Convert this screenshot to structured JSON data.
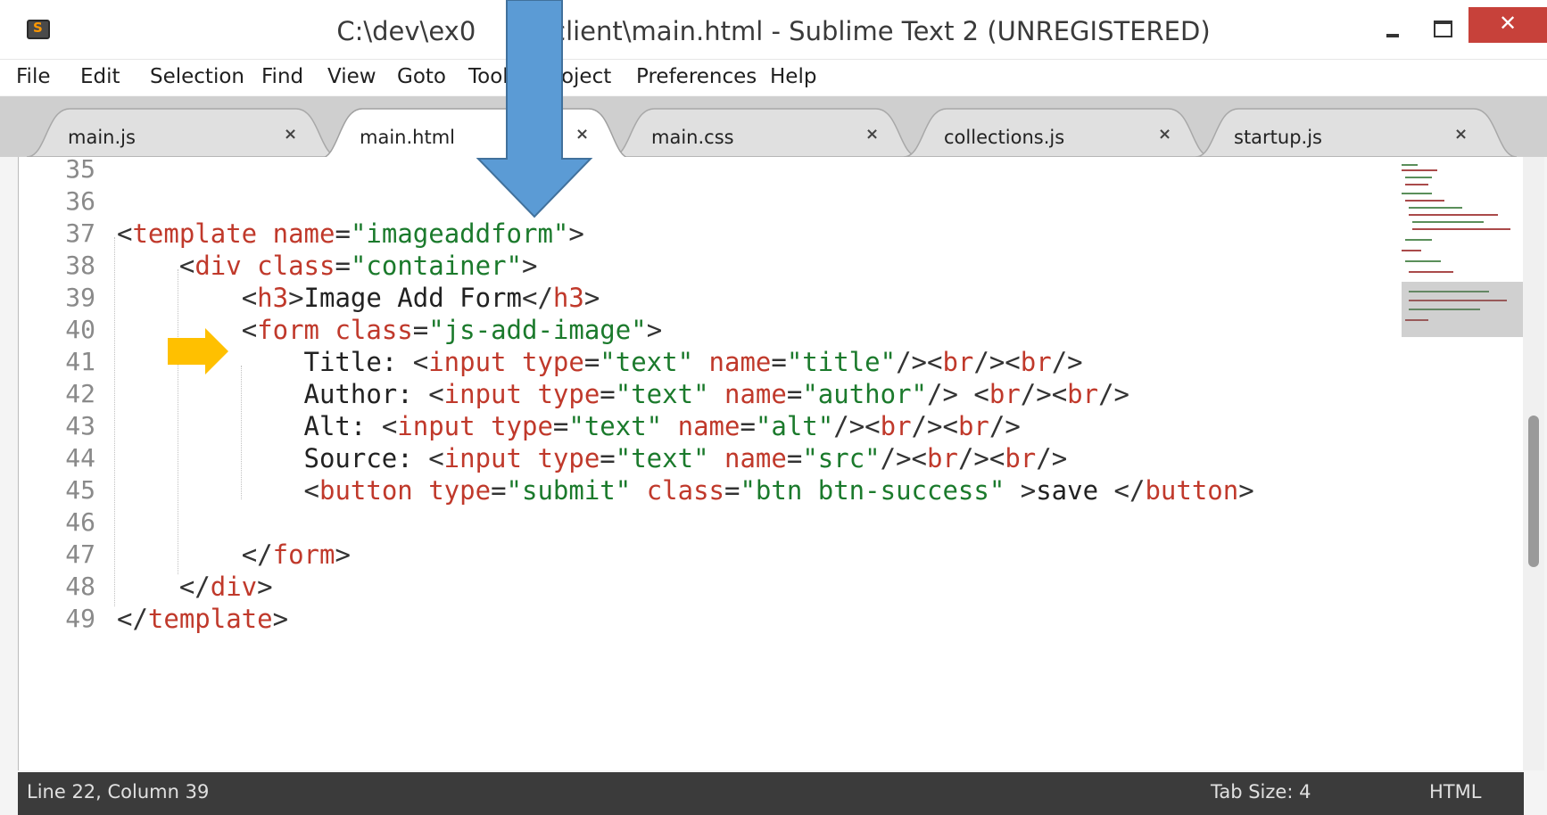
{
  "window": {
    "title": "C:\\dev\\ex0          v\\client\\main.html - Sublime Text 2 (UNREGISTERED)"
  },
  "menu": {
    "items": [
      "File",
      "Edit",
      "Selection",
      "Find",
      "View",
      "Goto",
      "Tool",
      "roject",
      "Preferences",
      "Help"
    ]
  },
  "tabs": [
    {
      "label": "main.js",
      "active": false
    },
    {
      "label": "main.html",
      "active": true
    },
    {
      "label": "main.css",
      "active": false
    },
    {
      "label": "collections.js",
      "active": false
    },
    {
      "label": "startup.js",
      "active": false
    }
  ],
  "tab_close_glyph": "×",
  "editor": {
    "line_numbers": [
      "35",
      "36",
      "37",
      "38",
      "39",
      "40",
      "41",
      "42",
      "43",
      "44",
      "45",
      "46",
      "47",
      "48",
      "49"
    ],
    "lines": [
      "",
      "",
      "<template name=\"imageaddform\">",
      "    <div class=\"container\">",
      "        <h3>Image Add Form</h3>",
      "        <form class=\"js-add-image\">",
      "            Title: <input type=\"text\" name=\"title\"/><br/><br/>",
      "            Author: <input type=\"text\" name=\"author\"/> <br/><br/>",
      "            Alt: <input type=\"text\" name=\"alt\"/><br/><br/>",
      "            Source: <input type=\"text\" name=\"src\"/><br/><br/>",
      "            <button type=\"submit\" class=\"btn btn-success\" >save </button>",
      "",
      "        </form>",
      "    </div>",
      "</template>"
    ]
  },
  "status": {
    "position": "Line 22, Column 39",
    "tab_size": "Tab Size: 4",
    "syntax": "HTML"
  },
  "colors": {
    "tag": "#c0392b",
    "string": "#1b7a2c",
    "annotation_blue": "#5b9bd5",
    "annotation_orange": "#ffc000",
    "close_button": "#c7413a"
  },
  "icons": {
    "app": "sublime-text-icon",
    "minimize": "minimize-icon",
    "maximize": "maximize-icon",
    "close": "close-icon",
    "annotation_down": "arrow-down-icon",
    "annotation_right": "arrow-right-icon"
  }
}
